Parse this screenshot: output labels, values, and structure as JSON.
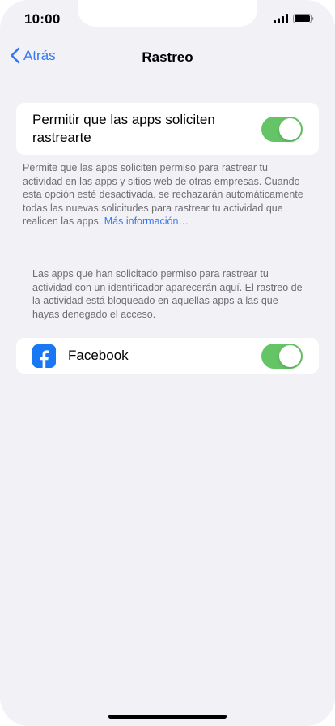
{
  "status_bar": {
    "time": "10:00"
  },
  "nav": {
    "back_label": "Atrás",
    "title": "Rastreo"
  },
  "allow_tracking": {
    "label": "Permitir que las apps soliciten rastrearte",
    "enabled": true
  },
  "allow_tracking_footer": {
    "text": "Permite que las apps soliciten permiso para rastrear tu actividad en las apps y sitios web de otras empresas. Cuando esta opción esté desactivada, se rechazarán automáticamente todas las nuevas solicitudes para rastrear tu actividad que realicen las apps.",
    "link": "Más información…"
  },
  "apps_footer": {
    "text": "Las apps que han solicitado permiso para rastrear tu actividad con un identificador aparecerán aquí. El rastreo de la actividad está bloqueado en aquellas apps a las que hayas denegado el acceso."
  },
  "apps": [
    {
      "name": "Facebook",
      "icon": "facebook-icon",
      "enabled": true
    }
  ],
  "colors": {
    "accent": "#3478f6",
    "toggle_on": "#65c466",
    "background": "#f1f1f6",
    "facebook": "#1877f2"
  }
}
